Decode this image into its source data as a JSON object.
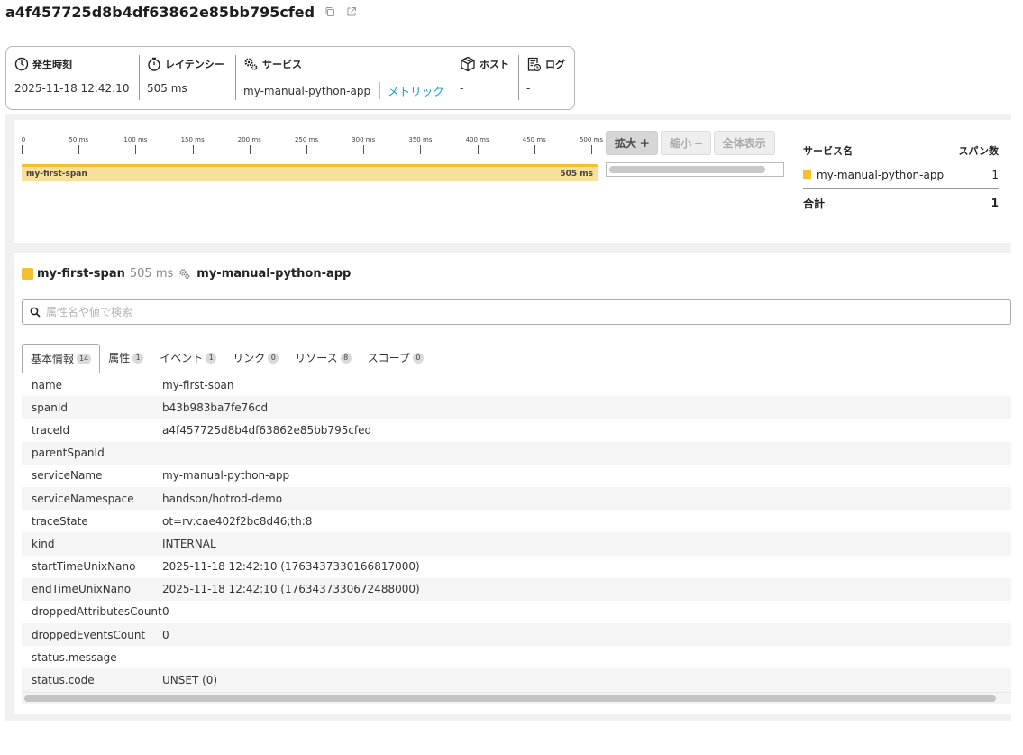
{
  "trace": {
    "id": "a4f457725d8b4df63862e85bb795cfed"
  },
  "summary": {
    "time_label": "発生時刻",
    "time_value": "2025-11-18 12:42:10",
    "latency_label": "レイテンシー",
    "latency_value": "505 ms",
    "service_label": "サービス",
    "service_value": "my-manual-python-app",
    "metrics_link": "メトリック",
    "host_label": "ホスト",
    "host_value": "-",
    "log_label": "ログ",
    "log_value": "-"
  },
  "timeline": {
    "ticks": [
      "0",
      "50 ms",
      "100 ms",
      "150 ms",
      "200 ms",
      "250 ms",
      "300 ms",
      "350 ms",
      "400 ms",
      "450 ms",
      "500 ms"
    ],
    "span_name": "my-first-span",
    "span_duration": "505 ms",
    "zoom_in": "拡大 ✚",
    "zoom_out": "縮小 ━",
    "show_all": "全体表示"
  },
  "services": {
    "col_name": "サービス名",
    "col_count": "スパン数",
    "rows": [
      {
        "name": "my-manual-python-app",
        "count": "1"
      }
    ],
    "total_label": "合計",
    "total_count": "1"
  },
  "detail": {
    "span_name": "my-first-span",
    "duration": "505 ms",
    "service": "my-manual-python-app",
    "search_placeholder": "属性名や値で検索",
    "tabs": [
      {
        "label": "基本情報",
        "count": "14"
      },
      {
        "label": "属性",
        "count": "1"
      },
      {
        "label": "イベント",
        "count": "1"
      },
      {
        "label": "リンク",
        "count": "0"
      },
      {
        "label": "リソース",
        "count": "8"
      },
      {
        "label": "スコープ",
        "count": "0"
      }
    ],
    "rows": [
      {
        "key": "name",
        "value": "my-first-span"
      },
      {
        "key": "spanId",
        "value": "b43b983ba7fe76cd"
      },
      {
        "key": "traceId",
        "value": "a4f457725d8b4df63862e85bb795cfed"
      },
      {
        "key": "parentSpanId",
        "value": ""
      },
      {
        "key": "serviceName",
        "value": "my-manual-python-app"
      },
      {
        "key": "serviceNamespace",
        "value": "handson/hotrod-demo"
      },
      {
        "key": "traceState",
        "value": "ot=rv:cae402f2bc8d46;th:8"
      },
      {
        "key": "kind",
        "value": "INTERNAL"
      },
      {
        "key": "startTimeUnixNano",
        "value": "2025-11-18 12:42:10 (1763437330166817000)"
      },
      {
        "key": "endTimeUnixNano",
        "value": "2025-11-18 12:42:10 (1763437330672488000)"
      },
      {
        "key": "droppedAttributesCount",
        "value": "0"
      },
      {
        "key": "droppedEventsCount",
        "value": "0"
      },
      {
        "key": "status.message",
        "value": ""
      },
      {
        "key": "status.code",
        "value": "UNSET (0)"
      }
    ]
  },
  "colors": {
    "span": "#f2c12e",
    "span_fill": "#f9e09a",
    "link": "#1a9fc6"
  }
}
